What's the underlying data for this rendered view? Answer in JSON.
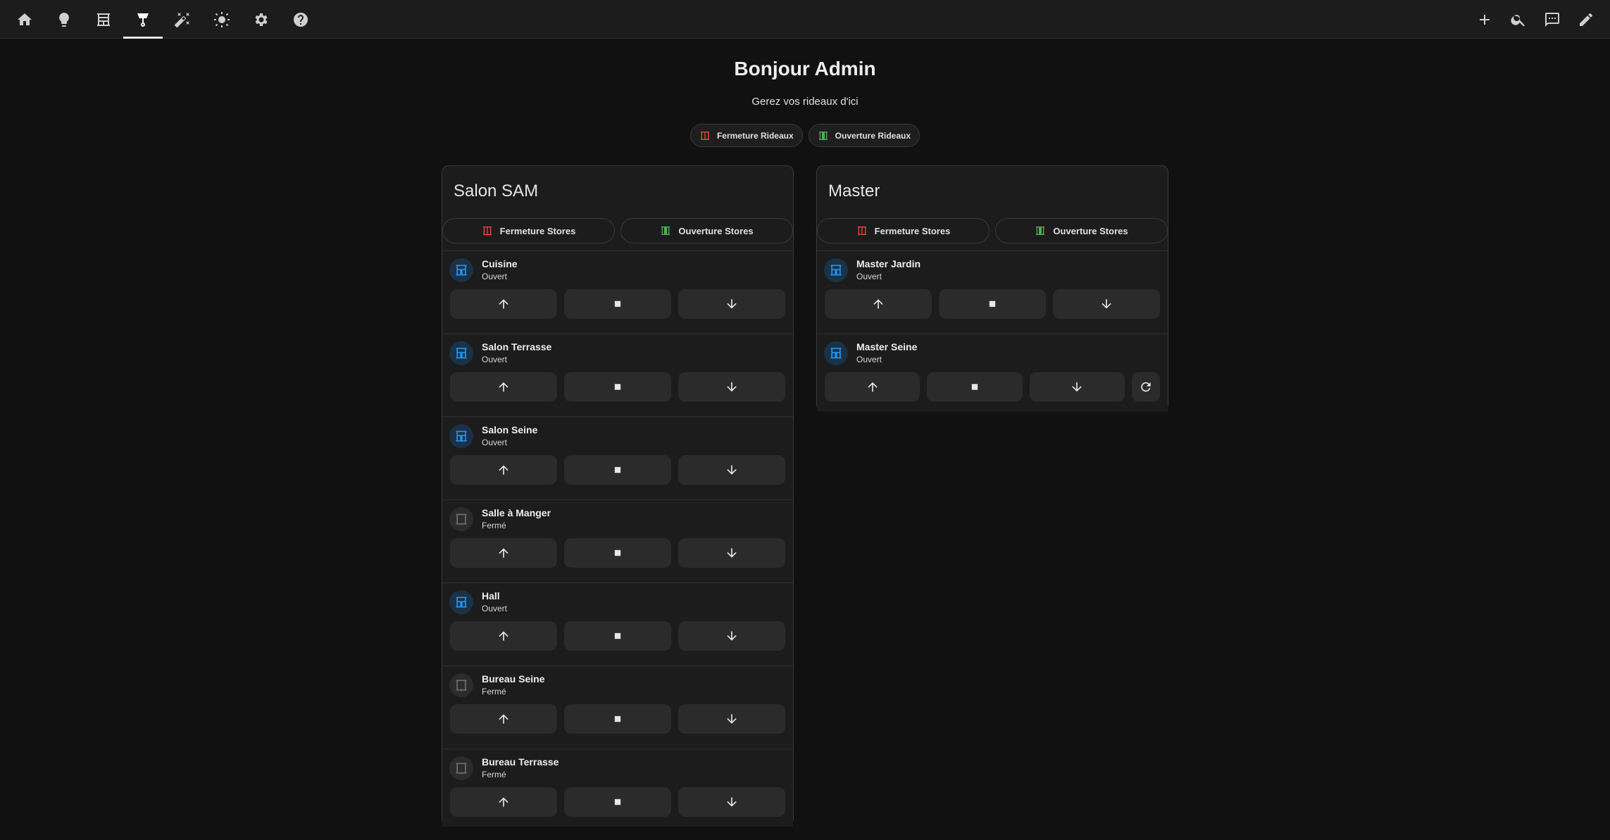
{
  "header": {
    "title": "Bonjour Admin",
    "subtitle": "Gerez vos rideaux d'ici",
    "chips": [
      {
        "label": "Fermeture Rideaux",
        "icon": "curtain-closed-icon",
        "color": "#f44336"
      },
      {
        "label": "Ouverture Rideaux",
        "icon": "curtain-open-icon",
        "color": "#4caf50"
      }
    ]
  },
  "nav": {
    "left_icons": [
      "home-icon",
      "lightbulb-icon",
      "blinds-icon",
      "lamp-icon",
      "magic-wand-icon",
      "sun-icon",
      "gear-icon",
      "help-icon"
    ],
    "active_index": 3,
    "right_icons": [
      "plus-icon",
      "search-icon",
      "assist-icon",
      "pencil-icon"
    ]
  },
  "colors": {
    "open_icon": "#2196f3",
    "closed_icon": "#6f6f6f",
    "close_chip": "#f44336",
    "open_chip": "#4caf50"
  },
  "cards": [
    {
      "title": "Salon SAM",
      "close_label": "Fermeture Stores",
      "open_label": "Ouverture Stores",
      "entities": [
        {
          "name": "Cuisine",
          "state": "Ouvert"
        },
        {
          "name": "Salon Terrasse",
          "state": "Ouvert"
        },
        {
          "name": "Salon Seine",
          "state": "Ouvert"
        },
        {
          "name": "Salle à Manger",
          "state": "Fermé"
        },
        {
          "name": "Hall",
          "state": "Ouvert"
        },
        {
          "name": "Bureau Seine",
          "state": "Fermé"
        },
        {
          "name": "Bureau Terrasse",
          "state": "Fermé"
        }
      ]
    },
    {
      "title": "Master",
      "close_label": "Fermeture Stores",
      "open_label": "Ouverture Stores",
      "entities": [
        {
          "name": "Master Jardin",
          "state": "Ouvert"
        },
        {
          "name": "Master Seine",
          "state": "Ouvert"
        }
      ]
    }
  ]
}
